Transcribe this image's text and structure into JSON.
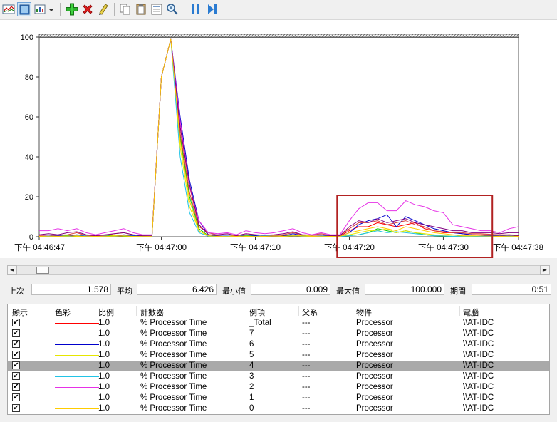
{
  "toolbar": {
    "buttons": [
      {
        "icon": "view-graph-icon"
      },
      {
        "icon": "view-histogram-icon",
        "selected": true
      },
      {
        "icon": "view-report-icon"
      },
      {
        "icon": "change-graph-type-dropdown-icon"
      },
      {
        "icon": "add-counter-icon"
      },
      {
        "icon": "delete-counter-icon"
      },
      {
        "icon": "highlight-icon"
      },
      {
        "icon": "copy-properties-icon"
      },
      {
        "icon": "paste-counter-list-icon"
      },
      {
        "icon": "properties-icon"
      },
      {
        "icon": "zoom-icon"
      },
      {
        "icon": "freeze-display-icon"
      },
      {
        "icon": "update-data-icon"
      }
    ]
  },
  "chart_data": {
    "type": "line",
    "ylim": [
      0,
      100
    ],
    "y_ticks": [
      "100",
      "80",
      "60",
      "40",
      "20",
      "0"
    ],
    "x_tick_labels": [
      "下午 04:46:47",
      "下午 04:47:00",
      "下午 04:47:10",
      "下午 04:47:20",
      "下午 04:47:30",
      "下午 04:47:38"
    ],
    "x_tick_seconds": [
      0,
      13,
      23,
      33,
      43,
      51
    ],
    "x_range_seconds": [
      0,
      51
    ],
    "highlight_box_seconds": [
      32,
      47
    ],
    "highlight_box_color": "#b22222",
    "series": [
      {
        "instance": "_Total",
        "color": "#ff0000",
        "values": [
          0.3,
          0.2,
          0.1,
          0.3,
          0.5,
          0.2,
          0.1,
          0.2,
          0.4,
          0.8,
          0.5,
          0.3,
          0.2,
          80,
          99,
          55,
          25,
          6,
          1,
          0.5,
          0.2,
          0.3,
          0.5,
          0.4,
          0.3,
          0.2,
          0.6,
          0.8,
          0.4,
          0.3,
          0.5,
          0.2,
          0.3,
          3,
          5,
          5,
          7,
          6,
          5,
          6,
          7,
          4,
          3,
          2,
          2,
          1.5,
          1,
          1,
          1,
          0.5,
          1,
          0.5
        ]
      },
      {
        "instance": "7",
        "color": "#00cc00",
        "values": [
          0.1,
          0,
          0.3,
          0.6,
          0.1,
          0.2,
          0,
          0.4,
          0.8,
          0.2,
          0.1,
          0.1,
          0.3,
          80,
          99,
          50,
          20,
          4,
          0.5,
          0.2,
          0.1,
          0.3,
          0.7,
          0.2,
          0.1,
          0.2,
          0.4,
          0.9,
          0.3,
          0.2,
          0.1,
          0.3,
          0.2,
          0.5,
          1,
          2,
          4,
          3,
          2,
          3,
          2,
          1,
          0.5,
          0.3,
          0.2,
          0.4,
          0.3,
          0.2,
          0.3,
          0.2,
          0.4,
          0.2
        ]
      },
      {
        "instance": "6",
        "color": "#0000cc",
        "values": [
          0.2,
          0.1,
          0.5,
          0.3,
          1,
          0.3,
          0.2,
          0.1,
          0.5,
          1,
          0.6,
          0.2,
          0.1,
          80,
          99,
          60,
          28,
          8,
          1,
          0.3,
          0.4,
          0.2,
          1,
          0.6,
          0.2,
          0.1,
          0.3,
          1.5,
          0.6,
          0.2,
          0.3,
          0.8,
          0.2,
          2,
          6,
          8,
          9,
          11,
          5,
          10,
          8,
          6,
          4,
          3,
          2,
          1.5,
          1,
          0.8,
          0.6,
          0.4,
          0.5,
          0.3
        ]
      },
      {
        "instance": "5",
        "color": "#e6e600",
        "values": [
          0,
          0.2,
          0.1,
          0.4,
          0.2,
          0.1,
          0.3,
          0.2,
          0.6,
          0.3,
          0.2,
          0.1,
          0.2,
          80,
          99,
          45,
          15,
          3,
          0.2,
          0.1,
          0.2,
          0.5,
          0.2,
          0.1,
          0.3,
          0.6,
          0.2,
          0.4,
          0.8,
          0.3,
          0.2,
          0.1,
          0.2,
          1,
          2,
          3,
          3,
          4,
          2,
          3,
          2,
          1.5,
          1,
          0.5,
          0.3,
          0.2,
          0.2,
          0.3,
          0.1,
          0.2,
          0.2,
          0.1
        ]
      },
      {
        "instance": "4",
        "color": "#d93f3f",
        "values": [
          0.5,
          0.4,
          0.8,
          1,
          2,
          0.6,
          0.3,
          0.6,
          1.5,
          2,
          1,
          0.5,
          0.3,
          80,
          99,
          52,
          22,
          5,
          2,
          0.8,
          1,
          0.5,
          1.5,
          1,
          0.6,
          0.5,
          1,
          2,
          1,
          0.8,
          1.5,
          0.6,
          0.5,
          4,
          7,
          7,
          8,
          6,
          7,
          8,
          6,
          5,
          3,
          2.5,
          2,
          2,
          1.5,
          1.5,
          1.2,
          1,
          1,
          0.8
        ]
      },
      {
        "instance": "3",
        "color": "#22c4e6",
        "values": [
          0.1,
          0.3,
          0.2,
          0.1,
          0.5,
          0.3,
          0.1,
          0.3,
          0.2,
          0.5,
          0.3,
          0.1,
          0.2,
          80,
          99,
          40,
          12,
          2,
          0.3,
          0.2,
          0.3,
          0.1,
          0.4,
          0.2,
          0.5,
          0.3,
          0.2,
          0.6,
          0.2,
          0.1,
          0.4,
          0.2,
          0.1,
          0.5,
          1,
          2,
          3,
          2,
          2.5,
          2,
          1.5,
          1,
          0.5,
          0.4,
          0.2,
          0.3,
          0.3,
          0.2,
          0.2,
          0.3,
          0.2,
          0.2
        ]
      },
      {
        "instance": "2",
        "color": "#e632e6",
        "values": [
          3,
          3,
          4,
          3,
          4,
          2,
          1,
          2,
          3,
          4,
          2,
          1,
          1,
          80,
          99,
          58,
          25,
          8,
          2,
          1.5,
          2,
          1,
          3,
          2,
          1.5,
          2,
          3,
          4,
          2,
          1,
          2,
          1,
          1,
          8,
          14,
          17,
          17,
          13,
          13,
          18,
          16,
          15,
          13,
          12,
          6,
          5,
          4,
          3,
          3,
          2,
          4,
          5
        ]
      },
      {
        "instance": "1",
        "color": "#800080",
        "values": [
          1,
          1.5,
          1,
          2,
          2.5,
          1,
          0.5,
          1,
          1.5,
          2,
          1,
          0.5,
          0.5,
          80,
          99,
          55,
          26,
          6,
          1,
          1,
          1.5,
          0.5,
          1.5,
          1,
          0.8,
          1,
          1.5,
          2.5,
          1,
          0.8,
          1,
          0.5,
          0.6,
          5,
          8,
          7,
          9,
          7,
          8,
          9,
          7,
          6,
          5,
          4,
          3,
          3,
          2,
          2,
          2,
          1.5,
          2,
          2
        ]
      },
      {
        "instance": "0",
        "color": "#ffcc00",
        "values": [
          0.2,
          0.1,
          0.2,
          0.3,
          0.4,
          0.1,
          0.2,
          0.1,
          0.3,
          0.4,
          0.2,
          0.1,
          0.2,
          80,
          99,
          48,
          18,
          3,
          0.5,
          0.2,
          0.1,
          0.2,
          0.3,
          0.1,
          0.2,
          0.3,
          0.2,
          0.5,
          0.3,
          0.2,
          0.1,
          0.2,
          0.1,
          2,
          3,
          4,
          5,
          4,
          3,
          5,
          4,
          3,
          2,
          1.5,
          1,
          0.5,
          0.5,
          0.4,
          0.3,
          0.2,
          0.3,
          0.2
        ]
      }
    ]
  },
  "scroll": {
    "left_arrow": "◄",
    "right_arrow": "►"
  },
  "stats": {
    "last_label": "上次",
    "last_value": "1.578",
    "avg_label": "平均",
    "avg_value": "6.426",
    "min_label": "最小值",
    "min_value": "0.009",
    "max_label": "最大值",
    "max_value": "100.000",
    "duration_label": "期間",
    "duration_value": "0:51"
  },
  "list": {
    "headers": {
      "show": "顯示",
      "color": "色彩",
      "scale": "比例",
      "counter": "計數器",
      "instance": "例項",
      "parent": "父系",
      "object": "物件",
      "computer": "電腦"
    },
    "check_glyph": "✔",
    "rows": [
      {
        "scale": "1.0",
        "counter": "% Processor Time",
        "instance": "_Total",
        "parent": "---",
        "object": "Processor",
        "computer": "\\\\AT-IDC",
        "color": "#ff0000",
        "selected": false
      },
      {
        "scale": "1.0",
        "counter": "% Processor Time",
        "instance": "7",
        "parent": "---",
        "object": "Processor",
        "computer": "\\\\AT-IDC",
        "color": "#00cc00",
        "selected": false
      },
      {
        "scale": "1.0",
        "counter": "% Processor Time",
        "instance": "6",
        "parent": "---",
        "object": "Processor",
        "computer": "\\\\AT-IDC",
        "color": "#0000cc",
        "selected": false
      },
      {
        "scale": "1.0",
        "counter": "% Processor Time",
        "instance": "5",
        "parent": "---",
        "object": "Processor",
        "computer": "\\\\AT-IDC",
        "color": "#e6e600",
        "selected": false
      },
      {
        "scale": "1.0",
        "counter": "% Processor Time",
        "instance": "4",
        "parent": "---",
        "object": "Processor",
        "computer": "\\\\AT-IDC",
        "color": "#d93f3f",
        "selected": true
      },
      {
        "scale": "1.0",
        "counter": "% Processor Time",
        "instance": "3",
        "parent": "---",
        "object": "Processor",
        "computer": "\\\\AT-IDC",
        "color": "#22c4e6",
        "selected": false
      },
      {
        "scale": "1.0",
        "counter": "% Processor Time",
        "instance": "2",
        "parent": "---",
        "object": "Processor",
        "computer": "\\\\AT-IDC",
        "color": "#e632e6",
        "selected": false
      },
      {
        "scale": "1.0",
        "counter": "% Processor Time",
        "instance": "1",
        "parent": "---",
        "object": "Processor",
        "computer": "\\\\AT-IDC",
        "color": "#800080",
        "selected": false
      },
      {
        "scale": "1.0",
        "counter": "% Processor Time",
        "instance": "0",
        "parent": "---",
        "object": "Processor",
        "computer": "\\\\AT-IDC",
        "color": "#ffcc00",
        "selected": false
      }
    ]
  }
}
